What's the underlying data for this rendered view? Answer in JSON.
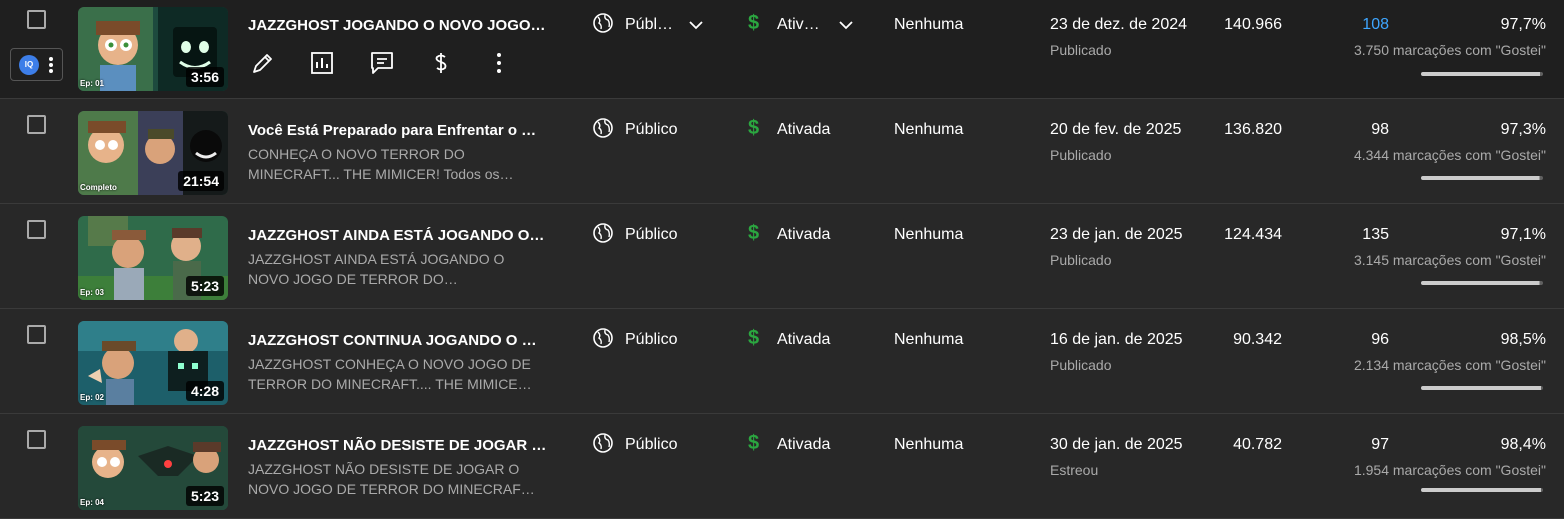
{
  "rows": [
    {
      "title": "JAZZGHOST JOGANDO O NOVO JOGO…",
      "description_l1": "",
      "description_l2": "",
      "duration": "3:56",
      "episode": "Ep: 01",
      "visibility": "Públ…",
      "monetization": "Ativ…",
      "restrictions": "Nenhuma",
      "date": "23 de dez. de 2024",
      "status": "Publicado",
      "views": "140.966",
      "comments": "108",
      "likes_pct": "97,7%",
      "likes_count": "3.750 marcações com \"Gostei\"",
      "likes_ratio": 0.977
    },
    {
      "title": "Você Está Preparado para Enfrentar o …",
      "description_l1": "CONHEÇA O NOVO TERROR DO",
      "description_l2": "MINECRAFT... THE MIMICER! Todos os…",
      "duration": "21:54",
      "episode": "Completo",
      "visibility": "Público",
      "monetization": "Ativada",
      "restrictions": "Nenhuma",
      "date": "20 de fev. de 2025",
      "status": "Publicado",
      "views": "136.820",
      "comments": "98",
      "likes_pct": "97,3%",
      "likes_count": "4.344 marcações com \"Gostei\"",
      "likes_ratio": 0.973
    },
    {
      "title": "JAZZGHOST AINDA ESTÁ JOGANDO O…",
      "description_l1": "JAZZGHOST AINDA ESTÁ JOGANDO O",
      "description_l2": "NOVO JOGO DE TERROR DO…",
      "duration": "5:23",
      "episode": "Ep: 03",
      "visibility": "Público",
      "monetization": "Ativada",
      "restrictions": "Nenhuma",
      "date": "23 de jan. de 2025",
      "status": "Publicado",
      "views": "124.434",
      "comments": "135",
      "likes_pct": "97,1%",
      "likes_count": "3.145 marcações com \"Gostei\"",
      "likes_ratio": 0.971
    },
    {
      "title": "JAZZGHOST CONTINUA JOGANDO O …",
      "description_l1": "JAZZGHOST CONHEÇA O NOVO JOGO DE",
      "description_l2": "TERROR DO MINECRAFT.... THE MIMICE…",
      "duration": "4:28",
      "episode": "Ep: 02",
      "visibility": "Público",
      "monetization": "Ativada",
      "restrictions": "Nenhuma",
      "date": "16 de jan. de 2025",
      "status": "Publicado",
      "views": "90.342",
      "comments": "96",
      "likes_pct": "98,5%",
      "likes_count": "2.134 marcações com \"Gostei\"",
      "likes_ratio": 0.985
    },
    {
      "title": "JAZZGHOST NÃO DESISTE DE JOGAR …",
      "description_l1": "JAZZGHOST NÃO DESISTE DE JOGAR O",
      "description_l2": "NOVO JOGO DE TERROR DO MINECRAFT.…",
      "duration": "5:23",
      "episode": "Ep: 04",
      "visibility": "Público",
      "monetization": "Ativada",
      "restrictions": "Nenhuma",
      "date": "30 de jan. de 2025",
      "status": "Estreou",
      "views": "40.782",
      "comments": "97",
      "likes_pct": "98,4%",
      "likes_count": "1.954 marcações com \"Gostei\"",
      "likes_ratio": 0.984
    }
  ],
  "extension": {
    "logo_text": "IQ"
  },
  "colors": {
    "monetization_green": "#2ba640",
    "link_blue": "#3ea6ff",
    "iq_blue": "#3d7ee8"
  }
}
